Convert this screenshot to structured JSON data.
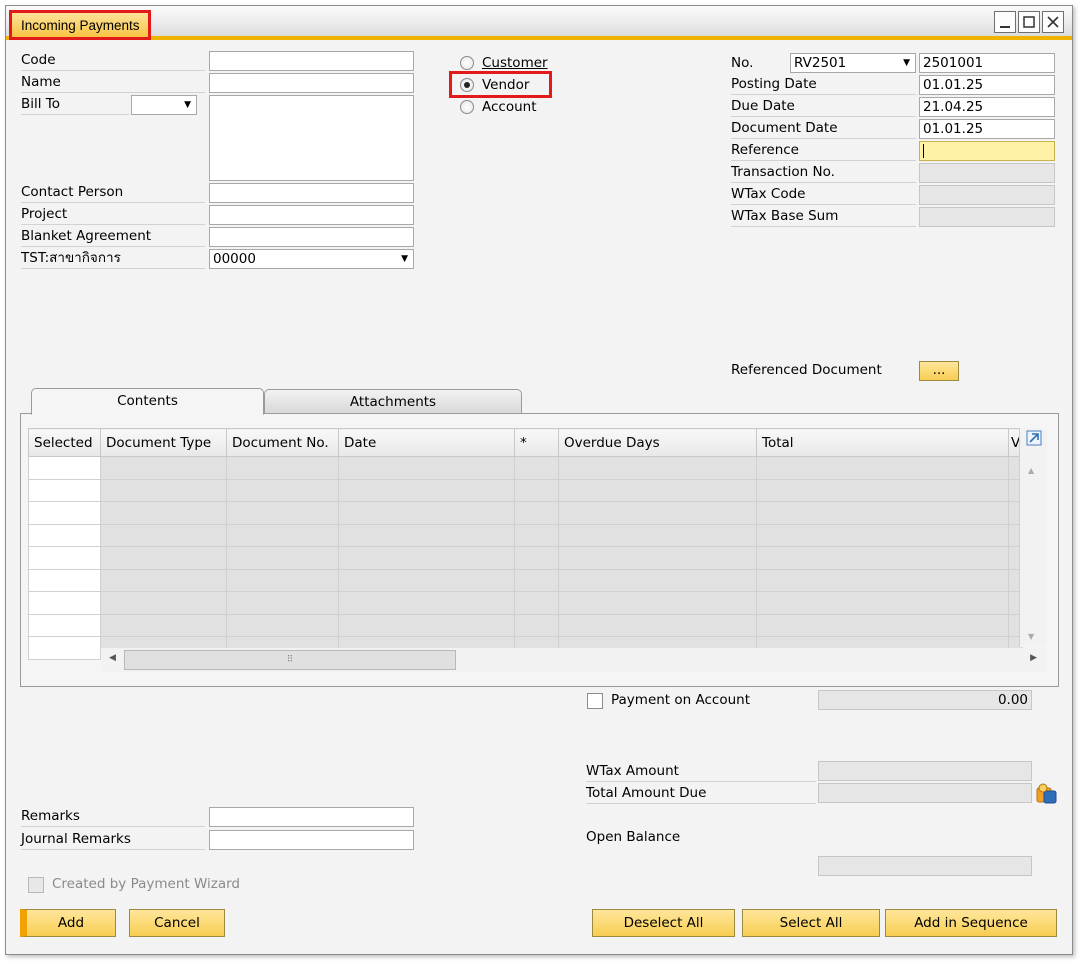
{
  "window": {
    "title": "Incoming Payments",
    "min_icon": "minimize-icon",
    "max_icon": "maximize-icon",
    "close_icon": "close-icon"
  },
  "left": {
    "code_label": "Code",
    "code_value": "",
    "name_label": "Name",
    "name_value": "",
    "bill_to_label": "Bill To",
    "bill_to_select": "",
    "bill_to_text": "",
    "contact_label": "Contact Person",
    "contact_value": "",
    "project_label": "Project",
    "project_value": "",
    "blanket_label": "Blanket Agreement",
    "blanket_value": "",
    "branch_label": "TST:สาขากิจการ",
    "branch_value": "00000"
  },
  "radio": {
    "customer": "Customer",
    "vendor": "Vendor",
    "account": "Account",
    "selected": "vendor"
  },
  "right": {
    "no_label": "No.",
    "series": "RV2501",
    "doc_number": "2501001",
    "posting_label": "Posting Date",
    "posting_value": "01.01.25",
    "due_label": "Due Date",
    "due_value": "21.04.25",
    "docdate_label": "Document Date",
    "docdate_value": "01.01.25",
    "reference_label": "Reference",
    "reference_value": "",
    "trans_label": "Transaction No.",
    "trans_value": "",
    "wtax_code_label": "WTax Code",
    "wtax_code_value": "",
    "wtax_base_label": "WTax Base Sum",
    "wtax_base_value": "",
    "refdoc_label": "Referenced Document",
    "refdoc_button": "..."
  },
  "tabs": [
    {
      "label": "Contents"
    },
    {
      "label": "Attachments"
    }
  ],
  "grid": {
    "columns": [
      "Selected",
      "Document Type",
      "Document No.",
      "Date",
      "*",
      "Overdue Days",
      "Total",
      "V"
    ],
    "row_count": 9
  },
  "footer": {
    "payment_on_account": "Payment on Account",
    "payment_on_account_value": "0.00",
    "wtax_amount_label": "WTax Amount",
    "wtax_amount_value": "",
    "total_due_label": "Total Amount Due",
    "total_due_value": "",
    "open_balance_label": "Open Balance",
    "open_balance_value": "",
    "remarks_label": "Remarks",
    "remarks_value": "",
    "journal_label": "Journal Remarks",
    "journal_value": "",
    "wizard_label": "Created by Payment Wizard"
  },
  "buttons": {
    "add": "Add",
    "cancel": "Cancel",
    "deselect_all": "Deselect All",
    "select_all": "Select All",
    "add_in_sequence": "Add in Sequence"
  },
  "colors": {
    "accent": "#f0b400",
    "highlight": "#e21a1a",
    "button": "#f7cd52",
    "reference_field": "#fff1a6"
  }
}
